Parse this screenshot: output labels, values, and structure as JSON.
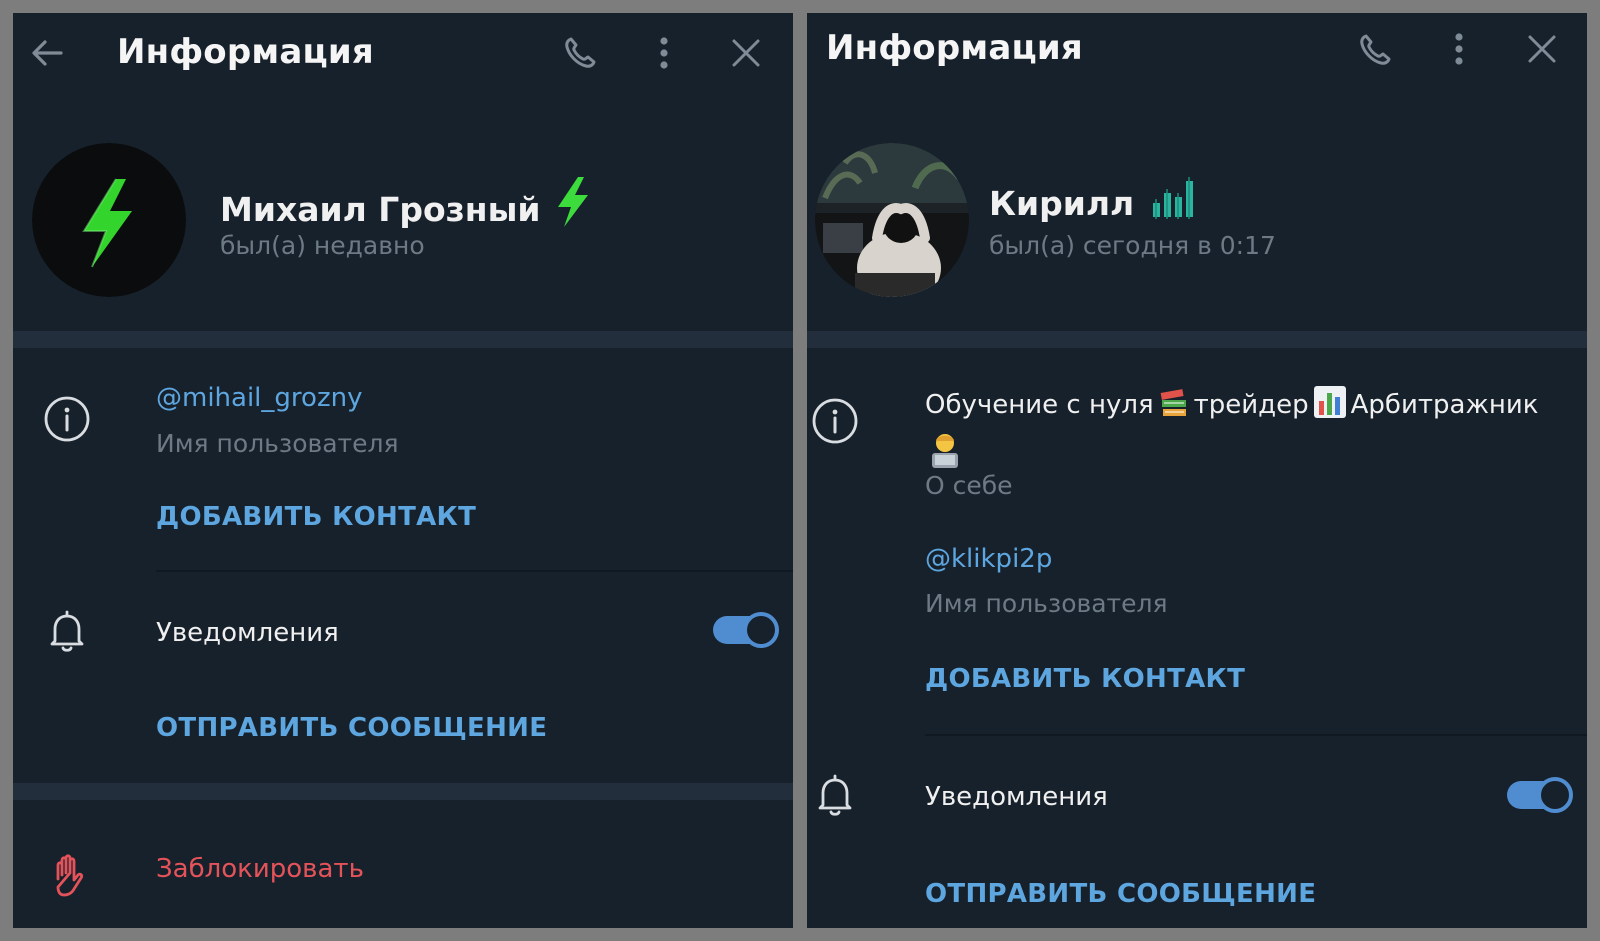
{
  "left": {
    "header": {
      "title": "Информация"
    },
    "profile": {
      "name": "Михаил Грозный",
      "status": "был(а) недавно"
    },
    "username": {
      "value": "@mihail_grozny",
      "label": "Имя пользователя"
    },
    "add_contact": "ДОБАВИТЬ КОНТАКТ",
    "notifications": {
      "label": "Уведомления",
      "enabled": true
    },
    "send_message": "ОТПРАВИТЬ СООБЩЕНИЕ",
    "block": "Заблокировать"
  },
  "right": {
    "header": {
      "title": "Информация"
    },
    "profile": {
      "name": "Кирилл",
      "status": "был(а) сегодня в 0:17"
    },
    "bio": {
      "part1": "Обучение с нуля",
      "part2": "трейдер",
      "part3": "Арбитражник",
      "label": "О себе"
    },
    "username": {
      "value": "@klikpi2p",
      "label": "Имя пользователя"
    },
    "add_contact": "ДОБАВИТЬ КОНТАКТ",
    "notifications": {
      "label": "Уведомления",
      "enabled": true
    },
    "send_message": "ОТПРАВИТЬ СООБЩЕНИЕ"
  },
  "colors": {
    "panel_bg": "#17212b",
    "separator": "#232e3c",
    "link": "#5ea6e0",
    "muted": "#6d7a86",
    "danger": "#e5535a",
    "toggle": "#4f8dd0",
    "lightning": "#3ddc3d"
  },
  "icons": {
    "back": "arrow-left-icon",
    "call": "phone-icon",
    "menu": "more-vertical-icon",
    "close": "close-icon",
    "info": "info-icon",
    "notifications": "bell-icon",
    "block": "hand-stop-icon",
    "name_badge_left": "lightning-emoji",
    "name_badge_right": "chart-emoji"
  }
}
